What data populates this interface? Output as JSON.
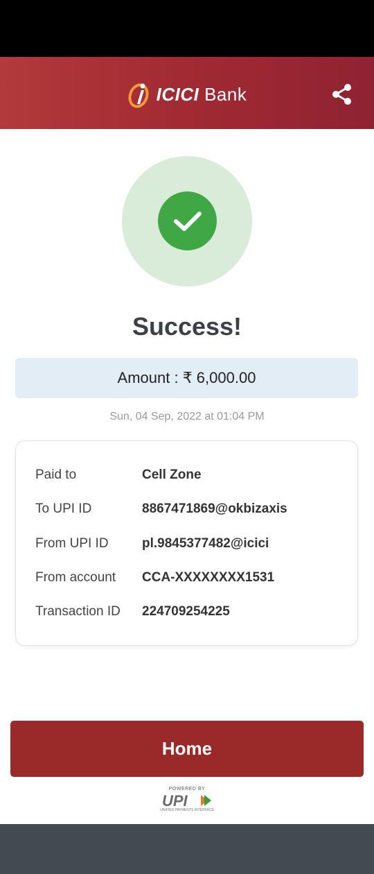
{
  "header": {
    "logo_name": "ICICI",
    "logo_bank": "Bank",
    "share_icon": "share-icon"
  },
  "status": {
    "title": "Success!",
    "icon": "check-icon"
  },
  "amount": {
    "text": "Amount : ₹ 6,000.00"
  },
  "timestamp": "Sun, 04 Sep, 2022 at 01:04 PM",
  "details": [
    {
      "label": "Paid to",
      "value": "Cell Zone"
    },
    {
      "label": "To UPI ID",
      "value": "8867471869@okbizaxis"
    },
    {
      "label": "From UPI ID",
      "value": "pl.9845377482@icici"
    },
    {
      "label": "From account",
      "value": "CCA-XXXXXXXX1531"
    },
    {
      "label": "Transaction ID",
      "value": "224709254225"
    }
  ],
  "home_button": "Home",
  "footer": {
    "powered_by": "POWERED BY",
    "upi": "UPI",
    "tagline": "UNIFIED PAYMENTS INTERFACE"
  },
  "colors": {
    "header": "#a32b33",
    "success": "#3fa845",
    "home_button": "#9a2a2a",
    "amount_bg": "#e3edf5"
  }
}
